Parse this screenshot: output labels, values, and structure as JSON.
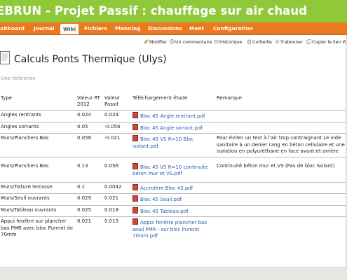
{
  "header": {
    "title": "EBRUN - Projet Passif : chauffage sur air chaud"
  },
  "menu": {
    "items": [
      "ashboard",
      "Journal",
      "Wiki",
      "Fichiers",
      "Planning",
      "Discussions",
      "Meet",
      "Configuration"
    ],
    "active": "Wiki"
  },
  "contextual": {
    "items": [
      "Modifier",
      "Un commentaire",
      "Historique",
      "Corbeille",
      "S'abonner",
      "Copier le lien W"
    ]
  },
  "page": {
    "title": "Calculs Ponts Thermique (Ulys)",
    "subtitle": "Une référence"
  },
  "table": {
    "headers": [
      "Type",
      "Valeur RT 2012",
      "Valeur Passif",
      "Téléchargement étude",
      "Remarque"
    ],
    "rows": [
      {
        "type": "Angles rentrants",
        "rt2012": "0.024",
        "passif": "0.024",
        "file": "Bloc 45 Angle rentrant.pdf",
        "remark": ""
      },
      {
        "type": "Angles sortants",
        "rt2012": "0.05",
        "passif": "-0.056",
        "file": "Bloc 45 Angle sortant.pdf",
        "remark": ""
      },
      {
        "type": "Murs/Planchers Bas",
        "rt2012": "0.058",
        "passif": "-0.021",
        "file": "Bloc 45 VS R=10 Bloc isolant.pdf",
        "remark": "Pour éviter un test à l'air trop contraignant Le vide sanitaire à un denier rang en béton cellulaire et une isolation en polyuréthane en face avant et arrière"
      },
      {
        "type": "Murs/Planchers Bas",
        "rt2012": "0.13",
        "passif": "0.056",
        "file": "Bloc 45 VS R=10 continuite béton mur et VS.pdf",
        "remark": "Continuité béton mur et VS (Pas de bloc isolant)"
      },
      {
        "type": "Murs/Toiture terrasse",
        "rt2012": "0.1",
        "passif": "0.0042",
        "file": "Accrotère Bloc 45.pdf",
        "remark": ""
      },
      {
        "type": "Murs/Seuil ouvrants",
        "rt2012": "0.029",
        "passif": "0.021",
        "file": "Bloc 45 Seuil.pdf",
        "remark": ""
      },
      {
        "type": "Murs/Tableau ouvrants",
        "rt2012": "0.025",
        "passif": "0.018",
        "file": "Bloc 45 Tableau.pdf",
        "remark": ""
      },
      {
        "type": "Appui fenêtre sur plancher bas PMR avec bloc Purenit de 70mm",
        "rt2012": "0.021",
        "passif": "0.013",
        "file": "Appui fenêtre plancher bas seuil PMR - sur bloc Purenit 70mm.pdf",
        "remark": ""
      }
    ]
  },
  "colors": {
    "header_green": "#8fc93a",
    "menu_orange": "#eb7a1f",
    "link_blue": "#2a5db0"
  }
}
